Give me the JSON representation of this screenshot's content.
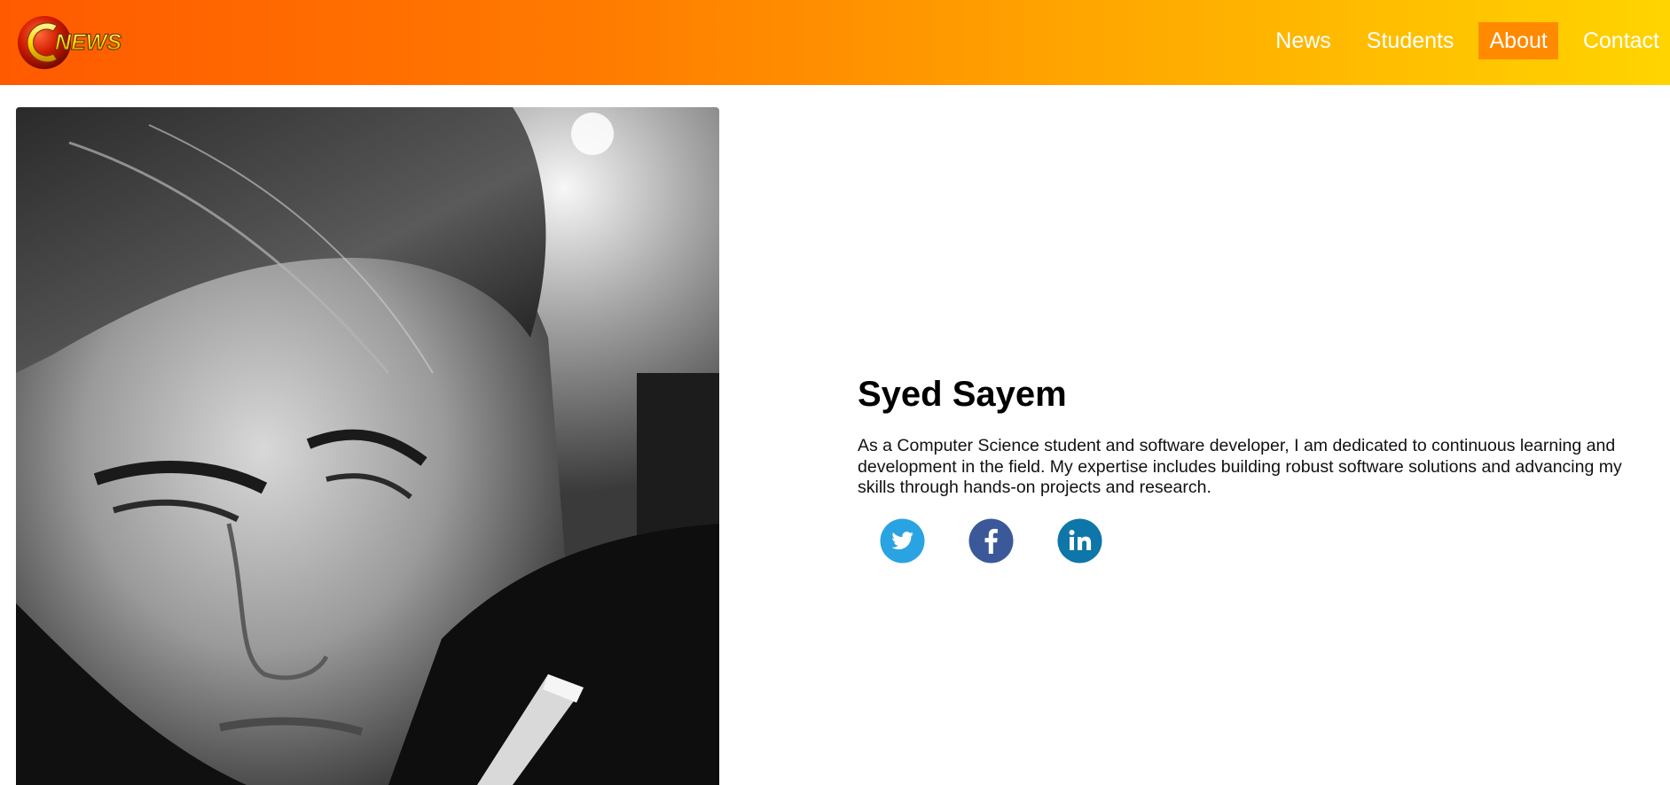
{
  "header": {
    "logo_text": "NEWS",
    "nav": [
      {
        "label": "News",
        "active": false
      },
      {
        "label": "Students",
        "active": false
      },
      {
        "label": "About",
        "active": true
      },
      {
        "label": "Contact",
        "active": false
      }
    ]
  },
  "profile": {
    "name": "Syed Sayem",
    "bio": "As a Computer Science student and software developer, I am dedicated to continuous learning and development in the field. My expertise includes building robust software solutions and advancing my skills through hands-on projects and research.",
    "socials": [
      {
        "icon": "twitter-icon",
        "color": "#2aa3e3"
      },
      {
        "icon": "facebook-icon",
        "color": "#3b5998"
      },
      {
        "icon": "linkedin-icon",
        "color": "#0e76a8"
      }
    ]
  },
  "colors": {
    "header_gradient_start": "#ff5a00",
    "header_gradient_end": "#ffd400",
    "active_nav_bg": "#ff8a00"
  }
}
